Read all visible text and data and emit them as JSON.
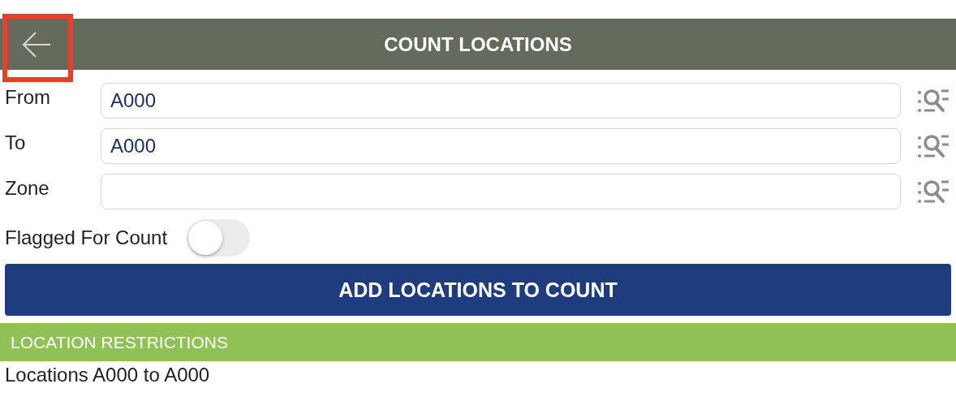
{
  "header": {
    "title": "COUNT LOCATIONS",
    "back_highlighted": true
  },
  "fields": [
    {
      "label": "From",
      "value": "A000"
    },
    {
      "label": "To",
      "value": "A000"
    },
    {
      "label": "Zone"
    }
  ],
  "flag_toggle": {
    "label": "Flagged For Count",
    "on": false
  },
  "add_button": "ADD LOCATIONS TO COUNT",
  "restrictions": {
    "title": "LOCATION RESTRICTIONS",
    "text": "Locations A000 to A000"
  }
}
